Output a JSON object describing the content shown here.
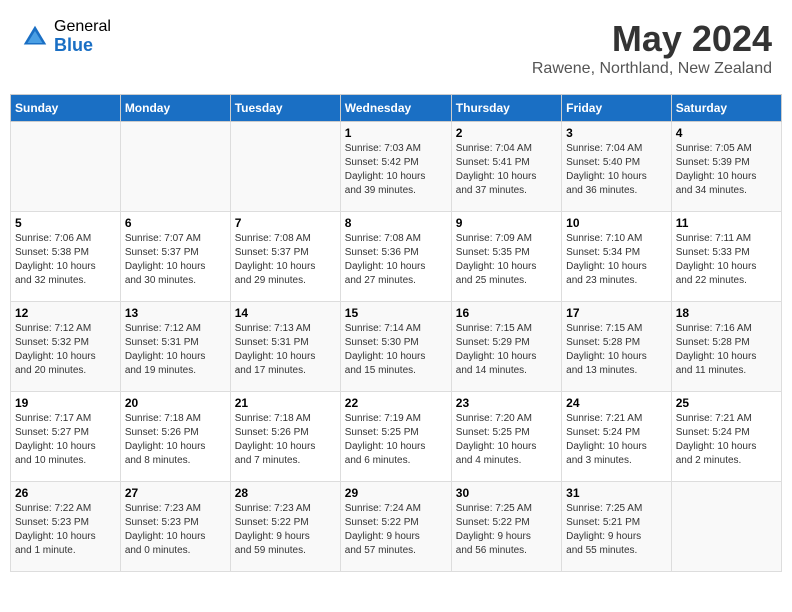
{
  "header": {
    "logo_general": "General",
    "logo_blue": "Blue",
    "title": "May 2024",
    "subtitle": "Rawene, Northland, New Zealand"
  },
  "days_of_week": [
    "Sunday",
    "Monday",
    "Tuesday",
    "Wednesday",
    "Thursday",
    "Friday",
    "Saturday"
  ],
  "weeks": [
    [
      {
        "day": "",
        "info": ""
      },
      {
        "day": "",
        "info": ""
      },
      {
        "day": "",
        "info": ""
      },
      {
        "day": "1",
        "info": "Sunrise: 7:03 AM\nSunset: 5:42 PM\nDaylight: 10 hours\nand 39 minutes."
      },
      {
        "day": "2",
        "info": "Sunrise: 7:04 AM\nSunset: 5:41 PM\nDaylight: 10 hours\nand 37 minutes."
      },
      {
        "day": "3",
        "info": "Sunrise: 7:04 AM\nSunset: 5:40 PM\nDaylight: 10 hours\nand 36 minutes."
      },
      {
        "day": "4",
        "info": "Sunrise: 7:05 AM\nSunset: 5:39 PM\nDaylight: 10 hours\nand 34 minutes."
      }
    ],
    [
      {
        "day": "5",
        "info": "Sunrise: 7:06 AM\nSunset: 5:38 PM\nDaylight: 10 hours\nand 32 minutes."
      },
      {
        "day": "6",
        "info": "Sunrise: 7:07 AM\nSunset: 5:37 PM\nDaylight: 10 hours\nand 30 minutes."
      },
      {
        "day": "7",
        "info": "Sunrise: 7:08 AM\nSunset: 5:37 PM\nDaylight: 10 hours\nand 29 minutes."
      },
      {
        "day": "8",
        "info": "Sunrise: 7:08 AM\nSunset: 5:36 PM\nDaylight: 10 hours\nand 27 minutes."
      },
      {
        "day": "9",
        "info": "Sunrise: 7:09 AM\nSunset: 5:35 PM\nDaylight: 10 hours\nand 25 minutes."
      },
      {
        "day": "10",
        "info": "Sunrise: 7:10 AM\nSunset: 5:34 PM\nDaylight: 10 hours\nand 23 minutes."
      },
      {
        "day": "11",
        "info": "Sunrise: 7:11 AM\nSunset: 5:33 PM\nDaylight: 10 hours\nand 22 minutes."
      }
    ],
    [
      {
        "day": "12",
        "info": "Sunrise: 7:12 AM\nSunset: 5:32 PM\nDaylight: 10 hours\nand 20 minutes."
      },
      {
        "day": "13",
        "info": "Sunrise: 7:12 AM\nSunset: 5:31 PM\nDaylight: 10 hours\nand 19 minutes."
      },
      {
        "day": "14",
        "info": "Sunrise: 7:13 AM\nSunset: 5:31 PM\nDaylight: 10 hours\nand 17 minutes."
      },
      {
        "day": "15",
        "info": "Sunrise: 7:14 AM\nSunset: 5:30 PM\nDaylight: 10 hours\nand 15 minutes."
      },
      {
        "day": "16",
        "info": "Sunrise: 7:15 AM\nSunset: 5:29 PM\nDaylight: 10 hours\nand 14 minutes."
      },
      {
        "day": "17",
        "info": "Sunrise: 7:15 AM\nSunset: 5:28 PM\nDaylight: 10 hours\nand 13 minutes."
      },
      {
        "day": "18",
        "info": "Sunrise: 7:16 AM\nSunset: 5:28 PM\nDaylight: 10 hours\nand 11 minutes."
      }
    ],
    [
      {
        "day": "19",
        "info": "Sunrise: 7:17 AM\nSunset: 5:27 PM\nDaylight: 10 hours\nand 10 minutes."
      },
      {
        "day": "20",
        "info": "Sunrise: 7:18 AM\nSunset: 5:26 PM\nDaylight: 10 hours\nand 8 minutes."
      },
      {
        "day": "21",
        "info": "Sunrise: 7:18 AM\nSunset: 5:26 PM\nDaylight: 10 hours\nand 7 minutes."
      },
      {
        "day": "22",
        "info": "Sunrise: 7:19 AM\nSunset: 5:25 PM\nDaylight: 10 hours\nand 6 minutes."
      },
      {
        "day": "23",
        "info": "Sunrise: 7:20 AM\nSunset: 5:25 PM\nDaylight: 10 hours\nand 4 minutes."
      },
      {
        "day": "24",
        "info": "Sunrise: 7:21 AM\nSunset: 5:24 PM\nDaylight: 10 hours\nand 3 minutes."
      },
      {
        "day": "25",
        "info": "Sunrise: 7:21 AM\nSunset: 5:24 PM\nDaylight: 10 hours\nand 2 minutes."
      }
    ],
    [
      {
        "day": "26",
        "info": "Sunrise: 7:22 AM\nSunset: 5:23 PM\nDaylight: 10 hours\nand 1 minute."
      },
      {
        "day": "27",
        "info": "Sunrise: 7:23 AM\nSunset: 5:23 PM\nDaylight: 10 hours\nand 0 minutes."
      },
      {
        "day": "28",
        "info": "Sunrise: 7:23 AM\nSunset: 5:22 PM\nDaylight: 9 hours\nand 59 minutes."
      },
      {
        "day": "29",
        "info": "Sunrise: 7:24 AM\nSunset: 5:22 PM\nDaylight: 9 hours\nand 57 minutes."
      },
      {
        "day": "30",
        "info": "Sunrise: 7:25 AM\nSunset: 5:22 PM\nDaylight: 9 hours\nand 56 minutes."
      },
      {
        "day": "31",
        "info": "Sunrise: 7:25 AM\nSunset: 5:21 PM\nDaylight: 9 hours\nand 55 minutes."
      },
      {
        "day": "",
        "info": ""
      }
    ]
  ]
}
